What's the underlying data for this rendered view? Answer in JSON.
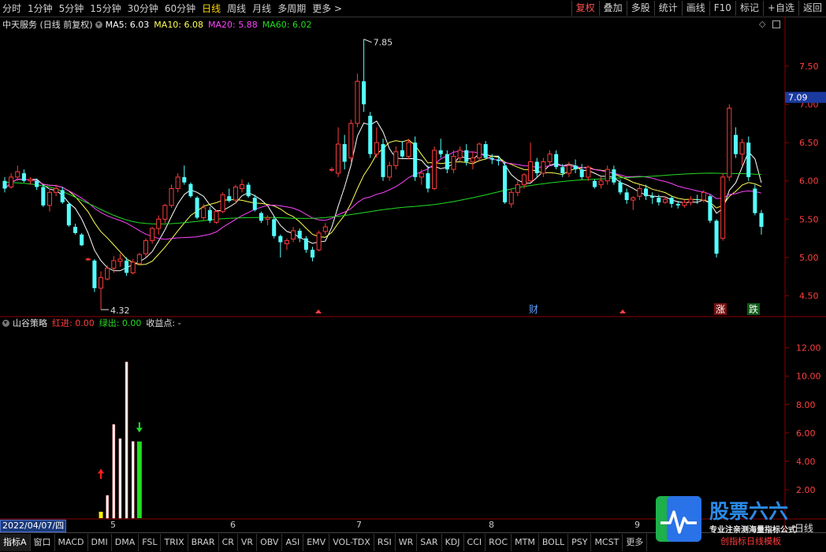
{
  "toolbar": {
    "timeframes": [
      "分时",
      "1分钟",
      "5分钟",
      "15分钟",
      "30分钟",
      "60分钟",
      "日线",
      "周线",
      "月线",
      "多周期",
      "更多 >"
    ],
    "active_timeframe": "日线",
    "right_buttons": [
      "复权",
      "叠加",
      "多股",
      "统计",
      "画线",
      "F10",
      "标记",
      "+自选",
      "返回"
    ]
  },
  "infoline": {
    "stock": "中天服务 (日线 前复权)",
    "ma5": "MA5: 6.03",
    "ma10": "MA10: 6.08",
    "ma20": "MA20: 5.88",
    "ma60": "MA60: 6.02"
  },
  "indicator": {
    "name": "山谷策略",
    "red_in": "红进: 0.00",
    "green_out": "绿出: 0.00",
    "profit": "收益点: -"
  },
  "price_axis": {
    "ticks": [
      "7.50",
      "7.00",
      "6.50",
      "6.00",
      "5.50",
      "5.00",
      "4.50"
    ],
    "current": "7.09"
  },
  "ind_axis": {
    "ticks": [
      "12.00",
      "10.00",
      "8.00",
      "6.00",
      "4.00",
      "2.00"
    ]
  },
  "annotations": {
    "high": "7.85",
    "low": "4.32",
    "caibao": "财",
    "zhang": "涨",
    "die": "跌"
  },
  "date_axis": {
    "cursor_date": "2022/04/07/四",
    "months": [
      "5",
      "6",
      "7",
      "8",
      "9"
    ],
    "period": "日线"
  },
  "bottom_tabs": [
    "指标A",
    "窗口",
    "MACD",
    "DMI",
    "DMA",
    "FSL",
    "TRIX",
    "BRAR",
    "CR",
    "VR",
    "OBV",
    "ASI",
    "EMV",
    "VOL-TDX",
    "RSI",
    "WR",
    "SAR",
    "KDJ",
    "CCI",
    "ROC",
    "MTM",
    "BOLL",
    "PSY",
    "MCST",
    "更多"
  ],
  "active_tab": "指标A",
  "logo": {
    "title": "股票六六",
    "subtitle": "专业注亲测海量指标公式",
    "overlay": "创指标日线模板"
  },
  "colors": {
    "up": "#ff3b3b",
    "down": "#54ffff",
    "ma5": "#ffffff",
    "ma10": "#ffff55",
    "ma20": "#ff44ff",
    "ma60": "#22dd22",
    "grid": "#8b0000"
  },
  "chart_data": {
    "type": "candlestick",
    "ylim": [
      4.25,
      7.95
    ],
    "candles": [
      [
        6.0,
        6.05,
        5.85,
        5.9
      ],
      [
        5.92,
        6.1,
        5.9,
        6.05
      ],
      [
        6.05,
        6.2,
        6.0,
        6.12
      ],
      [
        6.1,
        6.15,
        5.98,
        6.0
      ],
      [
        6.0,
        6.05,
        5.95,
        6.02
      ],
      [
        6.0,
        6.03,
        5.88,
        5.92
      ],
      [
        5.92,
        5.95,
        5.66,
        5.68
      ],
      [
        5.68,
        5.9,
        5.6,
        5.85
      ],
      [
        5.85,
        5.95,
        5.8,
        5.9
      ],
      [
        5.88,
        5.92,
        5.7,
        5.72
      ],
      [
        5.7,
        5.72,
        5.4,
        5.42
      ],
      [
        5.4,
        5.44,
        5.3,
        5.32
      ],
      [
        5.3,
        5.32,
        5.15,
        5.16
      ],
      [
        4.98,
        5.0,
        4.96,
        4.98
      ],
      [
        4.96,
        4.98,
        4.55,
        4.6
      ],
      [
        4.6,
        4.82,
        4.32,
        4.74
      ],
      [
        4.72,
        4.9,
        4.7,
        4.86
      ],
      [
        4.86,
        5.02,
        4.8,
        4.96
      ],
      [
        4.95,
        5.05,
        4.88,
        4.98
      ],
      [
        4.96,
        5.0,
        4.76,
        4.8
      ],
      [
        4.8,
        4.98,
        4.78,
        4.94
      ],
      [
        4.92,
        5.06,
        4.9,
        5.04
      ],
      [
        5.05,
        5.25,
        5.0,
        5.22
      ],
      [
        5.22,
        5.4,
        5.18,
        5.38
      ],
      [
        5.38,
        5.55,
        5.3,
        5.5
      ],
      [
        5.5,
        5.7,
        5.45,
        5.68
      ],
      [
        5.68,
        5.95,
        5.65,
        5.9
      ],
      [
        5.9,
        6.1,
        5.85,
        6.05
      ],
      [
        6.05,
        6.2,
        5.95,
        5.98
      ],
      [
        5.96,
        5.98,
        5.78,
        5.8
      ],
      [
        5.78,
        5.8,
        5.5,
        5.52
      ],
      [
        5.52,
        5.7,
        5.48,
        5.65
      ],
      [
        5.62,
        5.66,
        5.45,
        5.48
      ],
      [
        5.46,
        5.62,
        5.44,
        5.6
      ],
      [
        5.6,
        5.85,
        5.58,
        5.82
      ],
      [
        5.8,
        5.9,
        5.72,
        5.74
      ],
      [
        5.75,
        5.95,
        5.7,
        5.92
      ],
      [
        5.9,
        6.02,
        5.85,
        5.95
      ],
      [
        5.95,
        5.98,
        5.78,
        5.8
      ],
      [
        5.78,
        5.82,
        5.6,
        5.62
      ],
      [
        5.58,
        5.6,
        5.45,
        5.48
      ],
      [
        5.5,
        5.55,
        5.42,
        5.52
      ],
      [
        5.5,
        5.54,
        5.25,
        5.28
      ],
      [
        5.28,
        5.3,
        5.0,
        5.2
      ],
      [
        5.18,
        5.25,
        5.1,
        5.22
      ],
      [
        5.24,
        5.4,
        5.2,
        5.35
      ],
      [
        5.35,
        5.38,
        5.2,
        5.25
      ],
      [
        5.25,
        5.28,
        5.06,
        5.1
      ],
      [
        5.1,
        5.14,
        4.95,
        5.0
      ],
      [
        5.1,
        5.35,
        5.08,
        5.32
      ],
      [
        5.34,
        5.45,
        5.3,
        5.4
      ],
      [
        6.15,
        6.18,
        6.12,
        6.15
      ],
      [
        6.1,
        6.7,
        6.05,
        6.48
      ],
      [
        6.48,
        6.6,
        6.15,
        6.25
      ],
      [
        6.3,
        6.8,
        6.25,
        6.75
      ],
      [
        6.75,
        7.4,
        6.7,
        7.3
      ],
      [
        7.3,
        7.85,
        6.9,
        7.0
      ],
      [
        6.85,
        6.9,
        6.3,
        6.35
      ],
      [
        6.35,
        6.7,
        6.3,
        6.5
      ],
      [
        6.48,
        6.55,
        6.0,
        6.05
      ],
      [
        6.05,
        6.25,
        6.0,
        6.2
      ],
      [
        6.2,
        6.45,
        6.15,
        6.38
      ],
      [
        6.4,
        6.52,
        6.3,
        6.32
      ],
      [
        6.32,
        6.55,
        6.28,
        6.5
      ],
      [
        6.5,
        6.58,
        6.0,
        6.05
      ],
      [
        6.05,
        6.15,
        5.95,
        6.1
      ],
      [
        6.1,
        6.2,
        5.85,
        5.9
      ],
      [
        5.9,
        6.45,
        5.88,
        6.4
      ],
      [
        6.4,
        6.55,
        6.3,
        6.35
      ],
      [
        6.35,
        6.4,
        6.1,
        6.15
      ],
      [
        6.15,
        6.4,
        6.1,
        6.32
      ],
      [
        6.3,
        6.45,
        6.25,
        6.4
      ],
      [
        6.4,
        6.48,
        6.2,
        6.25
      ],
      [
        6.25,
        6.38,
        6.15,
        6.3
      ],
      [
        6.3,
        6.5,
        6.25,
        6.48
      ],
      [
        6.48,
        6.52,
        6.28,
        6.3
      ],
      [
        6.3,
        6.35,
        6.22,
        6.28
      ],
      [
        6.28,
        6.32,
        6.2,
        6.26
      ],
      [
        6.2,
        6.25,
        5.7,
        5.72
      ],
      [
        5.7,
        5.9,
        5.65,
        5.85
      ],
      [
        5.85,
        6.0,
        5.8,
        5.95
      ],
      [
        5.95,
        6.1,
        5.9,
        6.08
      ],
      [
        6.0,
        6.5,
        5.98,
        6.25
      ],
      [
        6.25,
        6.3,
        6.05,
        6.1
      ],
      [
        6.1,
        6.3,
        6.05,
        6.25
      ],
      [
        6.25,
        6.4,
        6.2,
        6.35
      ],
      [
        6.35,
        6.4,
        6.15,
        6.18
      ],
      [
        6.18,
        6.22,
        6.05,
        6.1
      ],
      [
        6.1,
        6.25,
        6.05,
        6.2
      ],
      [
        6.2,
        6.28,
        6.1,
        6.15
      ],
      [
        6.15,
        6.22,
        6.02,
        6.05
      ],
      [
        6.05,
        6.2,
        6.0,
        6.18
      ],
      [
        6.0,
        6.02,
        5.9,
        5.92
      ],
      [
        5.95,
        6.05,
        5.9,
        6.0
      ],
      [
        6.0,
        6.2,
        5.95,
        6.15
      ],
      [
        6.15,
        6.2,
        5.95,
        5.98
      ],
      [
        5.98,
        6.02,
        5.82,
        5.85
      ],
      [
        5.85,
        5.9,
        5.7,
        5.75
      ],
      [
        5.75,
        5.8,
        5.62,
        5.78
      ],
      [
        5.8,
        5.95,
        5.75,
        5.9
      ],
      [
        5.9,
        5.95,
        5.75,
        5.8
      ],
      [
        5.8,
        5.85,
        5.7,
        5.78
      ],
      [
        5.78,
        5.82,
        5.68,
        5.72
      ],
      [
        5.72,
        5.8,
        5.7,
        5.76
      ],
      [
        5.78,
        5.8,
        5.65,
        5.7
      ],
      [
        5.7,
        5.74,
        5.64,
        5.68
      ],
      [
        5.68,
        5.75,
        5.65,
        5.72
      ],
      [
        5.72,
        5.8,
        5.68,
        5.76
      ],
      [
        5.76,
        5.82,
        5.7,
        5.75
      ],
      [
        5.75,
        5.88,
        5.72,
        5.85
      ],
      [
        5.8,
        5.82,
        5.45,
        5.48
      ],
      [
        5.48,
        5.5,
        5.0,
        5.05
      ],
      [
        5.25,
        6.1,
        5.22,
        6.05
      ],
      [
        6.05,
        7.0,
        6.0,
        6.95
      ],
      [
        6.6,
        6.7,
        6.3,
        6.35
      ],
      [
        6.35,
        6.55,
        6.2,
        6.5
      ],
      [
        6.5,
        6.58,
        6.0,
        6.05
      ],
      [
        5.9,
        5.95,
        5.55,
        5.58
      ],
      [
        5.58,
        5.62,
        5.3,
        5.4
      ]
    ],
    "bars": [
      {
        "i": 15,
        "value": 0.45,
        "color": "yellow"
      },
      {
        "i": 16,
        "value": 1.6,
        "color": "white"
      },
      {
        "i": 17,
        "value": 6.6,
        "color": "white"
      },
      {
        "i": 18,
        "value": 5.6,
        "color": "white"
      },
      {
        "i": 19,
        "value": 11.0,
        "color": "white"
      },
      {
        "i": 20,
        "value": 5.4,
        "color": "white"
      },
      {
        "i": 21,
        "value": 5.4,
        "color": "green"
      }
    ],
    "ind_ylim": [
      0,
      13.2
    ]
  }
}
